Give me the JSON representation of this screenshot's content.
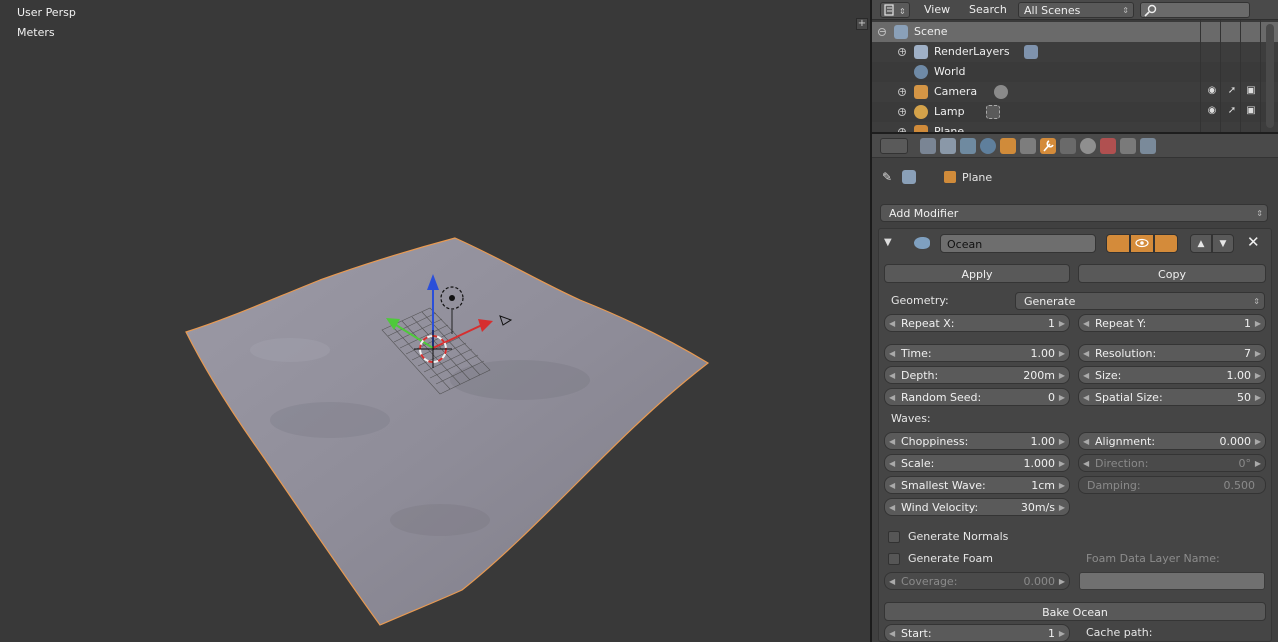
{
  "viewport": {
    "view_label": "User Persp",
    "units_label": "Meters"
  },
  "outliner": {
    "header": {
      "view_menu": "View",
      "search_menu": "Search",
      "scenes_select": "All Scenes"
    },
    "rows": [
      {
        "label": "Scene"
      },
      {
        "label": "RenderLayers"
      },
      {
        "label": "World"
      },
      {
        "label": "Camera"
      },
      {
        "label": "Lamp"
      },
      {
        "label": "Plane"
      }
    ]
  },
  "properties": {
    "context_object": "Plane",
    "add_modifier_label": "Add Modifier",
    "modifier": {
      "name": "Ocean",
      "apply_label": "Apply",
      "copy_label": "Copy",
      "geometry_label": "Geometry:",
      "geometry_value": "Generate",
      "repeat_x": {
        "label": "Repeat X:",
        "value": "1"
      },
      "repeat_y": {
        "label": "Repeat Y:",
        "value": "1"
      },
      "time": {
        "label": "Time:",
        "value": "1.00"
      },
      "resolution": {
        "label": "Resolution:",
        "value": "7"
      },
      "depth": {
        "label": "Depth:",
        "value": "200m"
      },
      "size": {
        "label": "Size:",
        "value": "1.00"
      },
      "random_seed": {
        "label": "Random Seed:",
        "value": "0"
      },
      "spatial_size": {
        "label": "Spatial Size:",
        "value": "50"
      },
      "waves_label": "Waves:",
      "choppiness": {
        "label": "Choppiness:",
        "value": "1.00"
      },
      "alignment": {
        "label": "Alignment:",
        "value": "0.000"
      },
      "scale": {
        "label": "Scale:",
        "value": "1.000"
      },
      "direction": {
        "label": "Direction:",
        "value": "0°"
      },
      "smallest_wave": {
        "label": "Smallest Wave:",
        "value": "1cm"
      },
      "damping": {
        "label": "Damping:",
        "value": "0.500"
      },
      "wind_velocity": {
        "label": "Wind Velocity:",
        "value": "30m/s"
      },
      "generate_normals_label": "Generate Normals",
      "generate_foam_label": "Generate Foam",
      "foam_layer_label": "Foam Data Layer Name:",
      "coverage": {
        "label": "Coverage:",
        "value": "0.000"
      },
      "bake_label": "Bake Ocean",
      "start": {
        "label": "Start:",
        "value": "1"
      },
      "cache_path_label": "Cache path:"
    }
  },
  "colors": {
    "viewport_bg": "#393939",
    "selection_outline": "#e89a52",
    "active_tab": "#d48b3a",
    "x_axis": "#d62f2f",
    "y_axis": "#4fc93b",
    "z_axis": "#2b4fd9"
  }
}
